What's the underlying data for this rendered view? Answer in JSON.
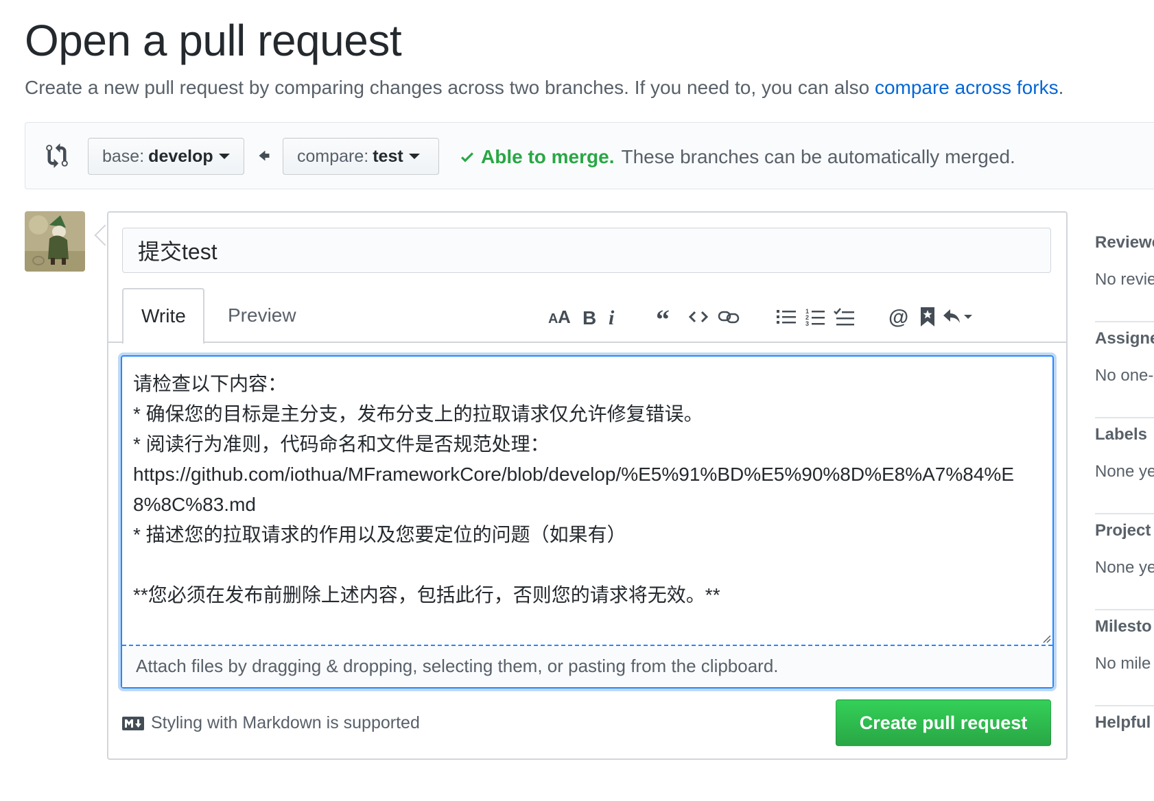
{
  "page": {
    "title": "Open a pull request",
    "subtitle": "Create a new pull request by comparing changes across two branches. If you need to, you can also ",
    "subtitle_link": "compare across forks",
    "subtitle_end": "."
  },
  "range": {
    "base_label": "base:",
    "base_branch": "develop",
    "compare_label": "compare:",
    "compare_branch": "test",
    "merge_ok": "Able to merge.",
    "merge_text": "These branches can be automatically merged."
  },
  "composer": {
    "title_value": "提交test",
    "tabs": [
      "Write",
      "Preview"
    ],
    "toolbar": [
      "header-text-icon",
      "bold-icon",
      "italic-icon",
      "quote-icon",
      "code-icon",
      "link-icon",
      "bulleted-list-icon",
      "numbered-list-icon",
      "task-list-icon",
      "mention-icon",
      "saved-reply-icon",
      "reply-icon"
    ],
    "body": "请检查以下内容：\n* 确保您的目标是主分支，发布分支上的拉取请求仅允许修复错误。\n* 阅读行为准则，代码命名和文件是否规范处理：\nhttps://github.com/iothua/MFrameworkCore/blob/develop/%E5%91%BD%E5%90%8D%E8%A7%84%E8%8C%83.md\n* 描述您的拉取请求的作用以及您要定位的问题（如果有）\n\n**您必须在发布前删除上述内容，包括此行，否则您的请求将无效。**",
    "attach_hint": "Attach files by dragging & dropping, selecting them, or pasting from the clipboard.",
    "markdown_hint": "Styling with Markdown is supported",
    "create_button": "Create pull request"
  },
  "sidebar": [
    {
      "head": "Reviewe",
      "value": "No revie"
    },
    {
      "head": "Assigne",
      "value": "No one-"
    },
    {
      "head": "Labels",
      "value": "None ye"
    },
    {
      "head": "Project",
      "value": "None ye"
    },
    {
      "head": "Milesto",
      "value": "No mile"
    },
    {
      "head": "Helpful",
      "value": ""
    }
  ],
  "colors": {
    "link": "#0366d6",
    "success": "#28a745",
    "focus": "#2188ff"
  }
}
